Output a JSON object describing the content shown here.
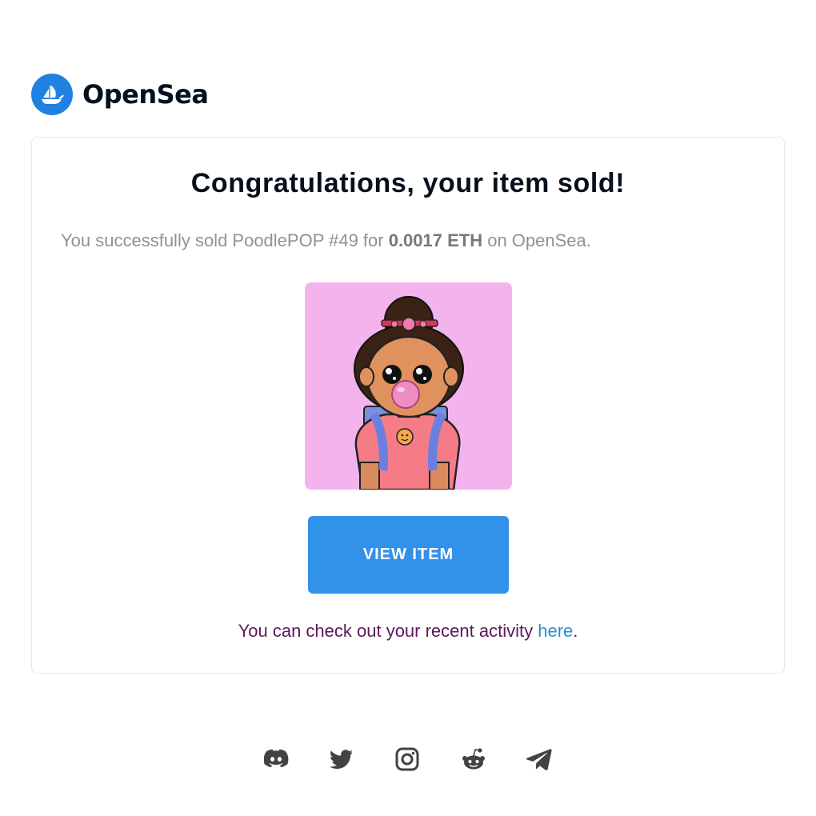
{
  "brand": {
    "name": "OpenSea",
    "color": "#2081e2"
  },
  "card": {
    "headline": "Congratulations, your item sold!",
    "message": {
      "prefix": "You successfully sold PoodlePOP #49 for ",
      "price": "0.0017 ETH",
      "suffix": " on OpenSea."
    },
    "item_image_alt": "PoodlePOP #49",
    "view_button_label": "VIEW ITEM",
    "button_color": "#3291e9",
    "activity": {
      "prefix": "You can check out your recent activity ",
      "link_label": "here",
      "suffix": "."
    }
  },
  "footer": {
    "socials": [
      {
        "icon": "discord-icon"
      },
      {
        "icon": "twitter-icon"
      },
      {
        "icon": "instagram-icon"
      },
      {
        "icon": "reddit-icon"
      },
      {
        "icon": "telegram-icon"
      }
    ]
  }
}
